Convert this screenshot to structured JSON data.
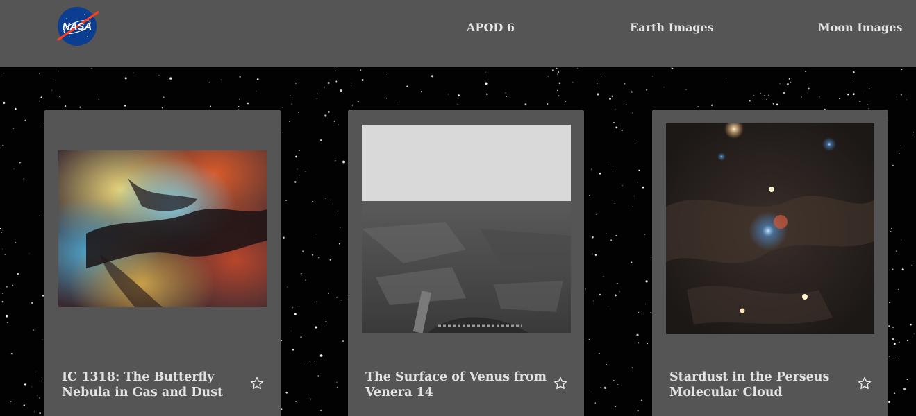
{
  "header": {
    "logo_text": "NASA",
    "nav": [
      {
        "label": "APOD 6"
      },
      {
        "label": "Earth Images"
      },
      {
        "label": "Moon Images"
      }
    ]
  },
  "cards": [
    {
      "title": "IC 1318: The Butterfly Nebula in Gas and Dust",
      "favorite_icon": "star-outline-icon"
    },
    {
      "title": "The Surface of Venus from Venera 14",
      "favorite_icon": "star-outline-icon"
    },
    {
      "title": "Stardust in the Perseus Molecular Cloud",
      "favorite_icon": "star-outline-icon"
    }
  ],
  "colors": {
    "header_bg": "#555555",
    "card_bg": "#555555",
    "text": "#e2e2e2",
    "background": "#020203"
  }
}
